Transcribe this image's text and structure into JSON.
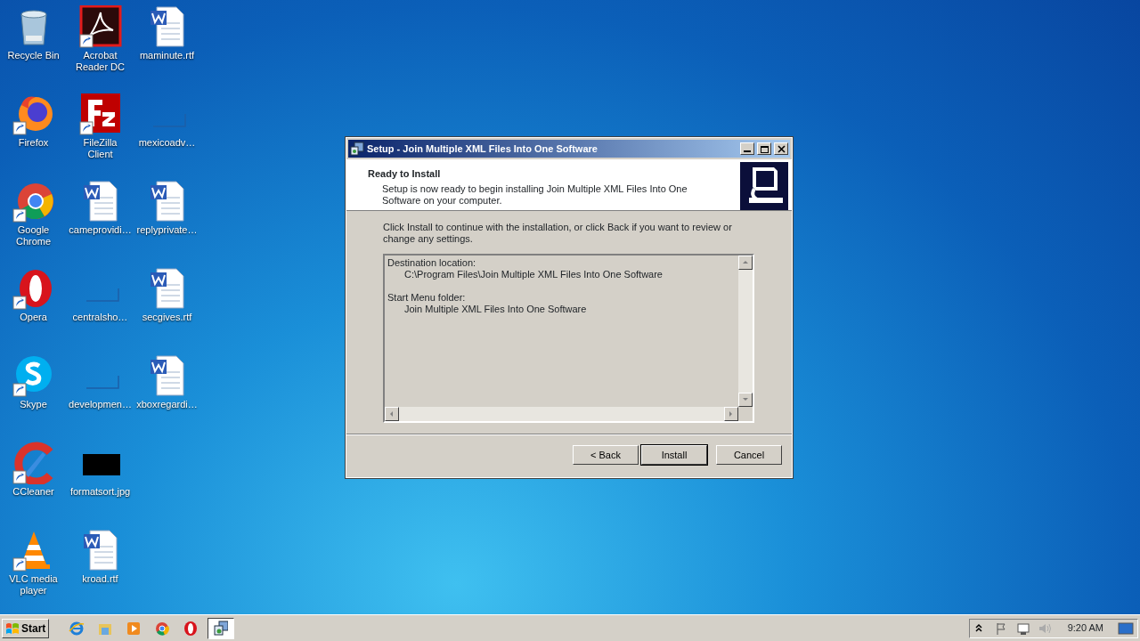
{
  "desktop_icons": [
    {
      "label": "Recycle Bin",
      "kind": "bin",
      "shortcut": false
    },
    {
      "label": "Firefox",
      "kind": "firefox",
      "shortcut": true
    },
    {
      "label": "Google Chrome",
      "kind": "chrome",
      "shortcut": true
    },
    {
      "label": "Opera",
      "kind": "opera",
      "shortcut": true
    },
    {
      "label": "Skype",
      "kind": "skype",
      "shortcut": true
    },
    {
      "label": "CCleaner",
      "kind": "ccleaner",
      "shortcut": true
    },
    {
      "label": "VLC media player",
      "kind": "vlc",
      "shortcut": true
    },
    {
      "label": "Acrobat Reader DC",
      "kind": "acrobat",
      "shortcut": true
    },
    {
      "label": "FileZilla Client",
      "kind": "filezilla",
      "shortcut": true
    },
    {
      "label": "cameprovidi…",
      "kind": "word",
      "shortcut": false
    },
    {
      "label": "centralsho…",
      "kind": "blank",
      "shortcut": false
    },
    {
      "label": "developmen…",
      "kind": "blank",
      "shortcut": false
    },
    {
      "label": "formatsort.jpg",
      "kind": "image",
      "shortcut": false
    },
    {
      "label": "kroad.rtf",
      "kind": "word",
      "shortcut": false
    },
    {
      "label": "maminute.rtf",
      "kind": "word",
      "shortcut": false
    },
    {
      "label": "mexicoadv…",
      "kind": "blank",
      "shortcut": false
    },
    {
      "label": "replyprivate…",
      "kind": "word",
      "shortcut": false
    },
    {
      "label": "secgives.rtf",
      "kind": "word",
      "shortcut": false
    },
    {
      "label": "xboxregardi…",
      "kind": "word",
      "shortcut": false
    }
  ],
  "dialog": {
    "title": "Setup - Join Multiple XML Files Into One Software",
    "heading": "Ready to Install",
    "subheading": "Setup is now ready to begin installing Join Multiple XML Files Into One Software on your computer.",
    "intro": "Click Install to continue with the installation, or click Back if you want to review or change any settings.",
    "summary": [
      {
        "heading": "Destination location:",
        "children": [
          {
            "text": "C:\\Program Files\\Join Multiple XML Files Into One Software"
          }
        ]
      },
      {
        "heading": "Start Menu folder:",
        "children": [
          {
            "text": "Join Multiple XML Files Into One Software"
          }
        ]
      }
    ],
    "buttons": [
      {
        "label": "< Back",
        "default": false
      },
      {
        "label": "Install",
        "default": true
      },
      {
        "label": "Cancel",
        "default": false
      }
    ]
  },
  "taskbar": {
    "start_label": "Start",
    "quick_launch": [
      {
        "kind": "ie"
      },
      {
        "kind": "explorer"
      },
      {
        "kind": "media"
      },
      {
        "kind": "chrome"
      },
      {
        "kind": "opera"
      }
    ],
    "tasks": [
      {
        "kind": "setup",
        "selected": true
      }
    ],
    "clock": "9:20 AM"
  }
}
